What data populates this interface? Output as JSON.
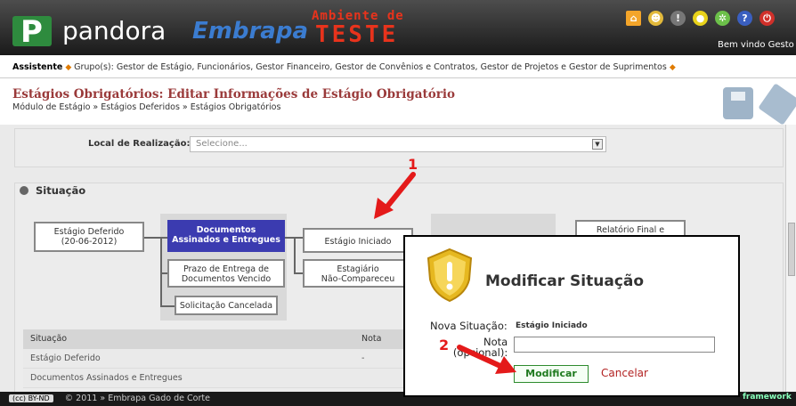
{
  "header": {
    "logo_letter": "P",
    "brand": "pandora",
    "org": "Embrapa",
    "environment_line1": "Ambiente de",
    "environment_line2": "TESTE",
    "welcome": "Bem vindo Gesto",
    "icons": [
      "home-icon",
      "user-icon",
      "alert-icon",
      "ring-icon",
      "settings-icon",
      "help-icon",
      "power-icon"
    ]
  },
  "userbar": {
    "user": "Assistente",
    "groups": "Grupo(s): Gestor de Estágio, Funcionários, Gestor Financeiro, Gestor de Convênios e Contratos, Gestor de Projetos e Gestor de Suprimentos"
  },
  "page": {
    "title_prefix": "Estágios Obrigatórios:",
    "title_rest": " Editar Informações de Estágio Obrigatório",
    "breadcrumb": "Módulo de Estágio » Estágios Deferidos » Estágios Obrigatórios"
  },
  "local": {
    "label": "Local de Realização:",
    "placeholder": "Selecione..."
  },
  "situacao": {
    "heading": "Situação",
    "boxes": {
      "deferido": "Estágio Deferido\n(20-06-2012)",
      "documentos": "Documentos\nAssinados e Entregues",
      "prazo": "Prazo de Entrega de\nDocumentos Vencido",
      "cancelada": "Solicitação Cancelada",
      "iniciado": "Estágio Iniciado",
      "nao_compareceu": "Estagiário\nNão-Compareceu",
      "relatorio": "Relatório Final e"
    },
    "table": {
      "headers": [
        "Situação",
        "Nota"
      ],
      "rows": [
        {
          "situacao": "Estágio Deferido",
          "nota": "-"
        },
        {
          "situacao": "Documentos Assinados e Entregues",
          "nota": ""
        }
      ]
    }
  },
  "modal": {
    "title": "Modificar Situação",
    "nova_situacao_label": "Nova Situação:",
    "nova_situacao_value": "Estágio Iniciado",
    "nota_label": "Nota",
    "nota_sub": "(opcional):",
    "nota_value": "",
    "modify_label": "Modificar",
    "cancel_label": "Cancelar"
  },
  "annotations": {
    "step1": "1",
    "step2": "2"
  },
  "footer": {
    "license": "(cc) BY-ND",
    "copyright": "© 2011 » Embrapa Gado de Corte",
    "framework": "framework"
  },
  "colors": {
    "header_bg": "#2b2b2b",
    "accent_red": "#e41a1a",
    "active_box": "#3b3bb0",
    "title_color": "#9a3a3a",
    "modify_green": "#2e8b2e"
  }
}
